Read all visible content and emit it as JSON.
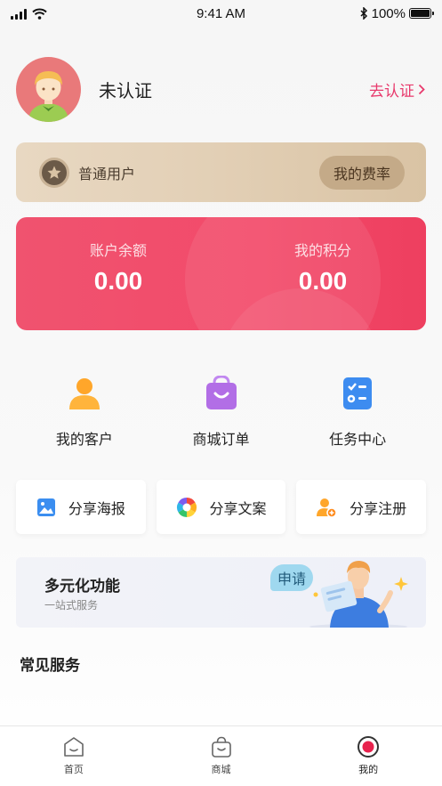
{
  "status_bar": {
    "time": "9:41 AM",
    "battery": "100%",
    "battery_level": 1.0
  },
  "profile": {
    "name": "未认证",
    "verify_link": "去认证"
  },
  "member_card": {
    "level": "普通用户",
    "rate_button": "我的费率"
  },
  "balance_card": {
    "balance_label": "账户余额",
    "balance_value": "0.00",
    "points_label": "我的积分",
    "points_value": "0.00"
  },
  "quick_menu": [
    {
      "label": "我的客户",
      "icon": "customer-icon"
    },
    {
      "label": "商城订单",
      "icon": "shopping-bag-icon"
    },
    {
      "label": "任务中心",
      "icon": "task-icon"
    }
  ],
  "share_buttons": [
    {
      "label": "分享海报",
      "icon": "image-icon"
    },
    {
      "label": "分享文案",
      "icon": "aperture-icon"
    },
    {
      "label": "分享注册",
      "icon": "add-user-icon"
    }
  ],
  "banner": {
    "title": "多元化功能",
    "subtitle": "一站式服务",
    "bubble": "申请"
  },
  "section": {
    "title": "常见服务"
  },
  "tabbar": [
    {
      "label": "首页",
      "icon": "home-icon"
    },
    {
      "label": "商城",
      "icon": "mall-bag-icon"
    },
    {
      "label": "我的",
      "icon": "profile-dot-icon",
      "active": true
    }
  ],
  "colors": {
    "accent_pink": "#e83a6d",
    "balance_card": "#f24a6a",
    "member_card": "#e2cfb5"
  }
}
